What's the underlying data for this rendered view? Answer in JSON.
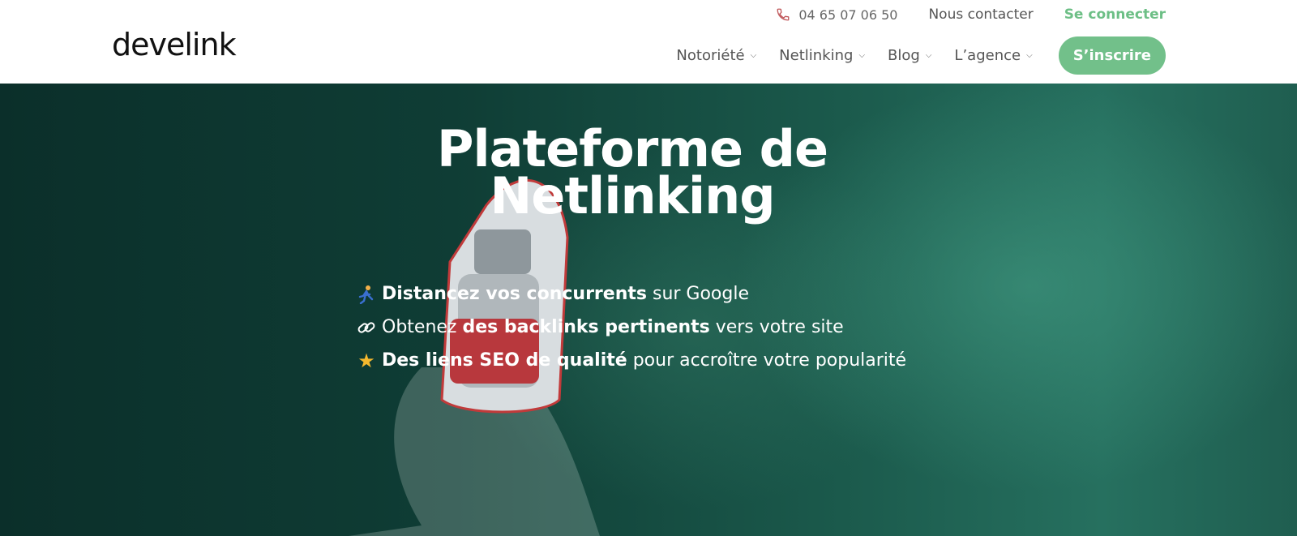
{
  "topbar": {
    "phone": "04 65 07 06 50",
    "contact": "Nous contacter",
    "login": "Se connecter"
  },
  "logo": {
    "text": "develink"
  },
  "nav": {
    "items": [
      {
        "label": "Notoriété"
      },
      {
        "label": "Netlinking"
      },
      {
        "label": "Blog"
      },
      {
        "label": "L’agence"
      }
    ],
    "signup": "S’inscrire"
  },
  "hero": {
    "title_line1": "Plateforme de",
    "title_line2": "Netlinking",
    "features": [
      {
        "icon": "runner-icon",
        "bold": "Distancez vos concurrents",
        "rest": " sur Google"
      },
      {
        "icon": "link-icon",
        "pre": "Obtenez ",
        "bold": "des backlinks pertinents",
        "rest": " vers votre site"
      },
      {
        "icon": "star-icon",
        "bold": "Des liens SEO de qualité",
        "rest": " pour accroître votre popularité"
      }
    ]
  },
  "colors": {
    "accent": "#72c08a",
    "login": "#6dbf86",
    "hero_bg": "#0f3d35"
  }
}
